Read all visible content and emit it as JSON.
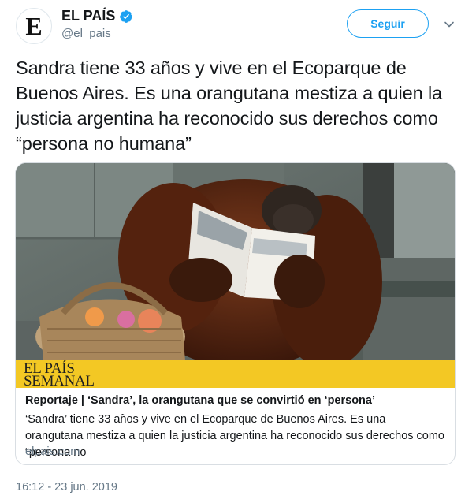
{
  "account": {
    "avatar_letter": "E",
    "display_name": "EL PAÍS",
    "handle": "@el_pais",
    "verified_icon": "verified-badge-icon"
  },
  "follow_label": "Seguir",
  "tweet_text": "Sandra tiene 33 años y vive en el Ecoparque de Buenos Aires. Es una orangutana mestiza a quien la justicia argentina ha reconocido sus derechos como “persona no humana”",
  "card": {
    "brand_line1": "EL PAÍS",
    "brand_line2": "SEMANAL",
    "title": "Reportaje | ‘Sandra’, la orangutana que se convirtió en ‘persona’",
    "description": "‘Sandra’ tiene 33 años y vive en el Ecoparque de Buenos Aires. Es una orangutana mestiza a quien la justicia argentina ha reconocido sus derechos como “persona no",
    "domain": "elpais.com"
  },
  "timestamp": "16:12 - 23 jun. 2019",
  "colors": {
    "accent": "#1da1f2",
    "text": "#14171a",
    "muted": "#657786",
    "brand_bar": "#f3c824"
  }
}
